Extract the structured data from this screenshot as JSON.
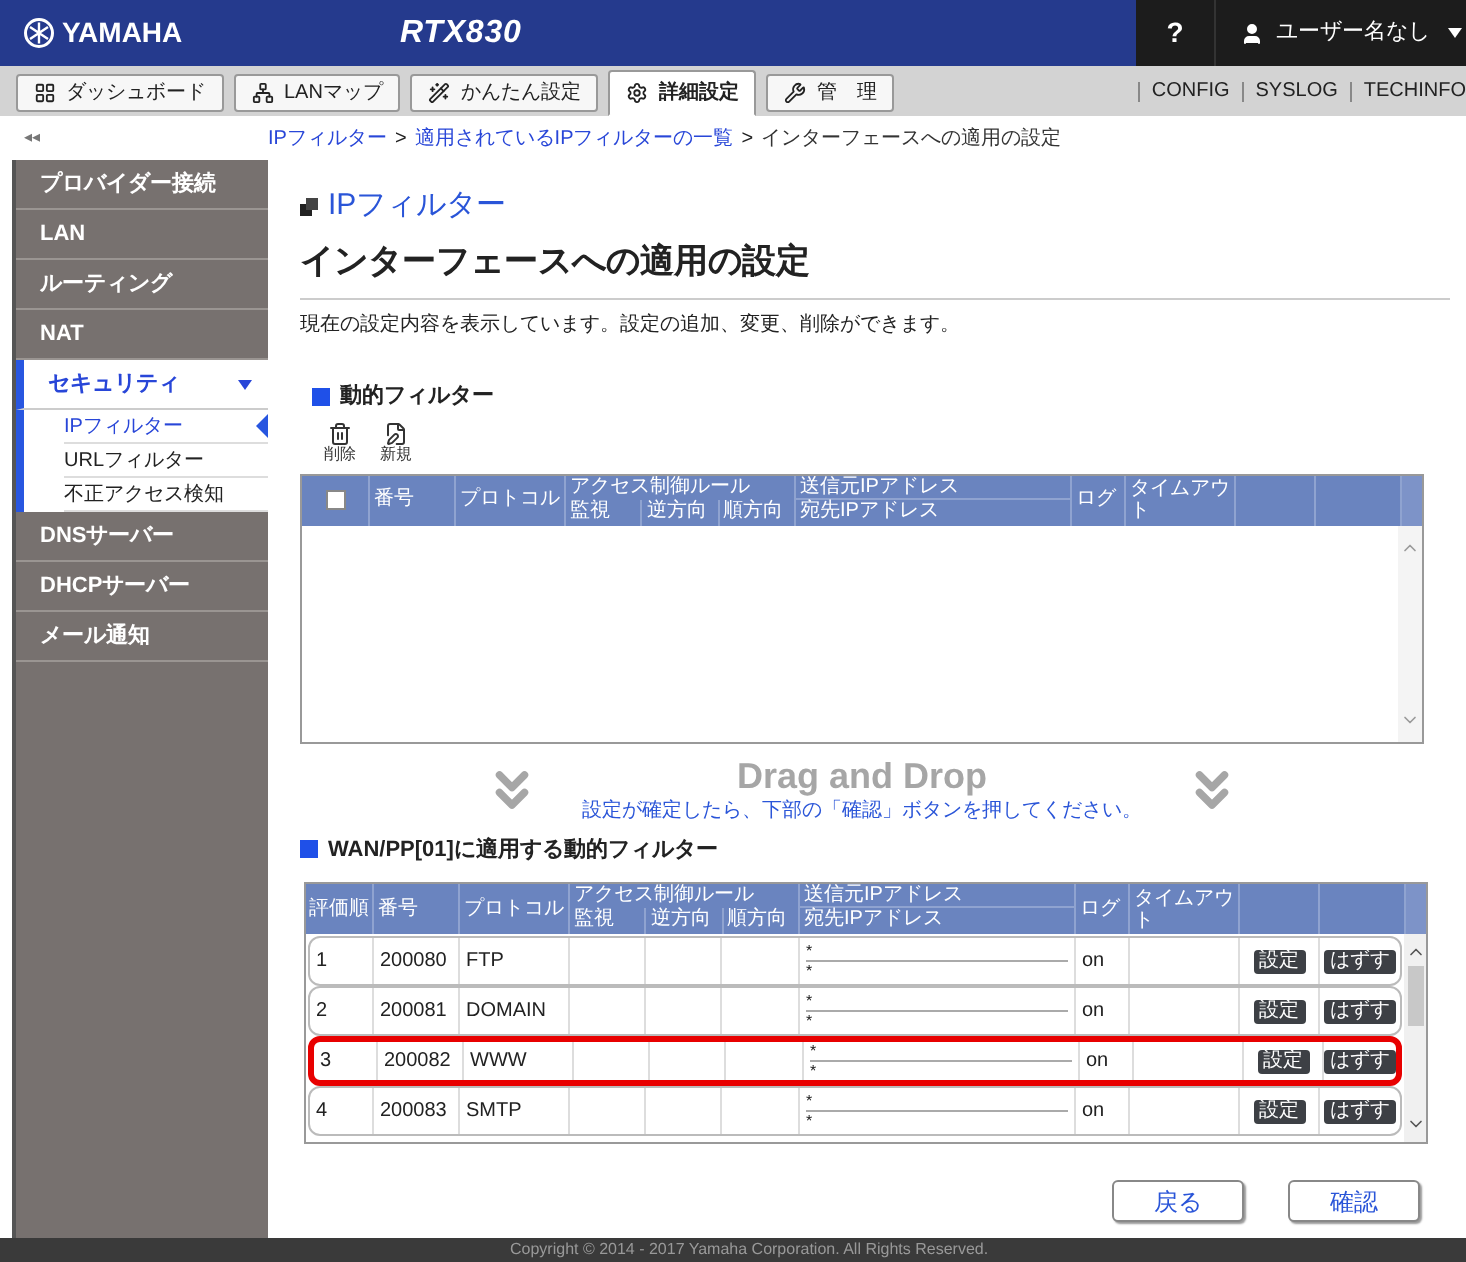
{
  "header": {
    "logo": "YAMAHA",
    "model": "RTX830",
    "help": "?",
    "user": "ユーザー名なし"
  },
  "tabs": [
    {
      "label": "ダッシュボード",
      "selected": false
    },
    {
      "label": "LANマップ",
      "selected": false
    },
    {
      "label": "かんたん設定",
      "selected": false
    },
    {
      "label": "詳細設定",
      "selected": true
    },
    {
      "label": "管　理",
      "selected": false
    }
  ],
  "links": [
    "CONFIG",
    "SYSLOG",
    "TECHINFO"
  ],
  "collapse": "◂◂",
  "breadcrumb": {
    "separator": ">",
    "items": [
      {
        "label": "IPフィルター",
        "link": true
      },
      {
        "label": "適用されているIPフィルターの一覧",
        "link": true
      },
      {
        "label": "インターフェースへの適用の設定",
        "link": false
      }
    ]
  },
  "sidebar": {
    "items": [
      {
        "label": "プロバイダー接続",
        "selected": false
      },
      {
        "label": "LAN",
        "selected": false
      },
      {
        "label": "ルーティング",
        "selected": false
      },
      {
        "label": "NAT",
        "selected": false
      },
      {
        "label": "セキュリティ",
        "selected": true,
        "expanded": true,
        "children": [
          {
            "label": "IPフィルター",
            "selected": true
          },
          {
            "label": "URLフィルター",
            "selected": false
          },
          {
            "label": "不正アクセス検知",
            "selected": false
          }
        ]
      },
      {
        "label": "DNSサーバー",
        "selected": false
      },
      {
        "label": "DHCPサーバー",
        "selected": false
      },
      {
        "label": "メール通知",
        "selected": false
      }
    ]
  },
  "page": {
    "section": "IPフィルター",
    "title": "インターフェースへの適用の設定",
    "description": "現在の設定内容を表示しています。設定の追加、変更、削除ができます。"
  },
  "dynamic_filter": {
    "heading": "動的フィルター",
    "toolbar": [
      "削除",
      "新規"
    ],
    "select_all": {
      "checked": false
    },
    "columns": {
      "number": "番号",
      "protocol": "プロトコル",
      "access": "アクセス制御ルール",
      "access_sub": [
        "監視",
        "逆方向",
        "順方向"
      ],
      "src": "送信元IPアドレス",
      "dst": "宛先IPアドレス",
      "log": "ログ",
      "timeout": "タイムアウト"
    }
  },
  "drag_drop": {
    "title": "Drag and Drop",
    "hint": "設定が確定したら、下部の「確認」ボタンを押してください。"
  },
  "applied": {
    "heading": "WAN/PP[01]に適用する動的フィルター",
    "columns": {
      "order": "評価順",
      "number": "番号",
      "protocol": "プロトコル",
      "access": "アクセス制御ルール",
      "access_sub": [
        "監視",
        "逆方向",
        "順方向"
      ],
      "src": "送信元IPアドレス",
      "dst": "宛先IPアドレス",
      "log": "ログ",
      "timeout": "タイムアウト"
    },
    "rows": [
      {
        "order": "1",
        "number": "200080",
        "protocol": "FTP",
        "src": "*",
        "dst": "*",
        "log": "on",
        "highlighted": false,
        "buttons": [
          "設定",
          "はずす"
        ]
      },
      {
        "order": "2",
        "number": "200081",
        "protocol": "DOMAIN",
        "src": "*",
        "dst": "*",
        "log": "on",
        "highlighted": false,
        "buttons": [
          "設定",
          "はずす"
        ]
      },
      {
        "order": "3",
        "number": "200082",
        "protocol": "WWW",
        "src": "*",
        "dst": "*",
        "log": "on",
        "highlighted": true,
        "buttons": [
          "設定",
          "はずす"
        ]
      },
      {
        "order": "4",
        "number": "200083",
        "protocol": "SMTP",
        "src": "*",
        "dst": "*",
        "log": "on",
        "highlighted": false,
        "buttons": [
          "設定",
          "はずす"
        ]
      }
    ]
  },
  "actions": [
    "戻る",
    "確認"
  ],
  "footer": "Copyright © 2014 - 2017 Yamaha Corporation. All Rights Reserved."
}
